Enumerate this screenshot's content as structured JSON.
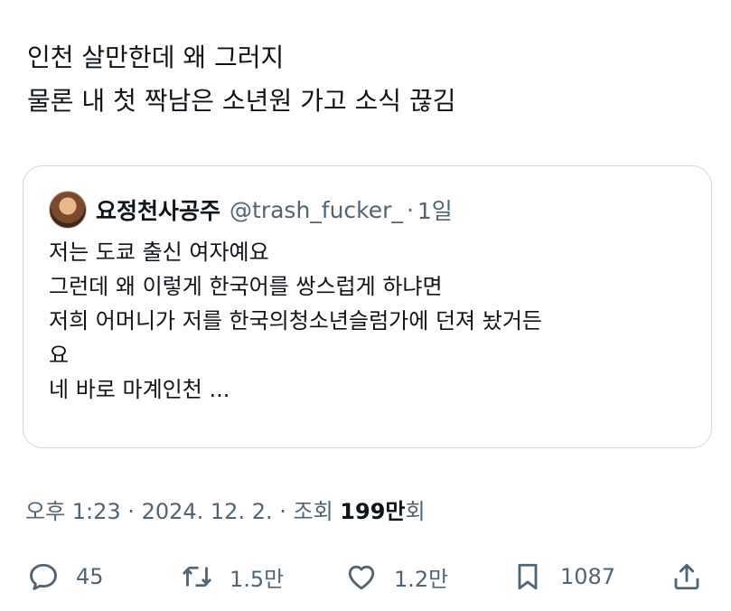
{
  "tweet": {
    "lines": [
      "인천 살만한데 왜 그러지",
      "물론 내 첫 짝남은 소년원 가고 소식 끊김"
    ]
  },
  "quote": {
    "display_name": "요정천사공주",
    "handle": "@trash_fucker_",
    "separator": "·",
    "time": "1일",
    "lines": [
      "저는 도쿄 출신 여자예요",
      "그런데 왜 이렇게 한국어를 쌍스럽게 하냐면",
      "저희 어머니가 저를 한국의청소년슬럼가에 던져 놨거든",
      "요",
      "네 바로 마계인천 ..."
    ]
  },
  "meta": {
    "timestamp": "오후 1:23 · 2024. 12. 2. · 조회",
    "views_number": "199만",
    "views_suffix": "회"
  },
  "actions": {
    "replies": "45",
    "retweets": "1.5만",
    "likes": "1.2만",
    "bookmarks": "1087",
    "icons": [
      "reply-icon",
      "retweet-icon",
      "like-icon",
      "bookmark-icon",
      "share-icon"
    ]
  },
  "colors": {
    "text": "#0f1419",
    "secondary": "#536471",
    "border": "#cfd9de"
  }
}
